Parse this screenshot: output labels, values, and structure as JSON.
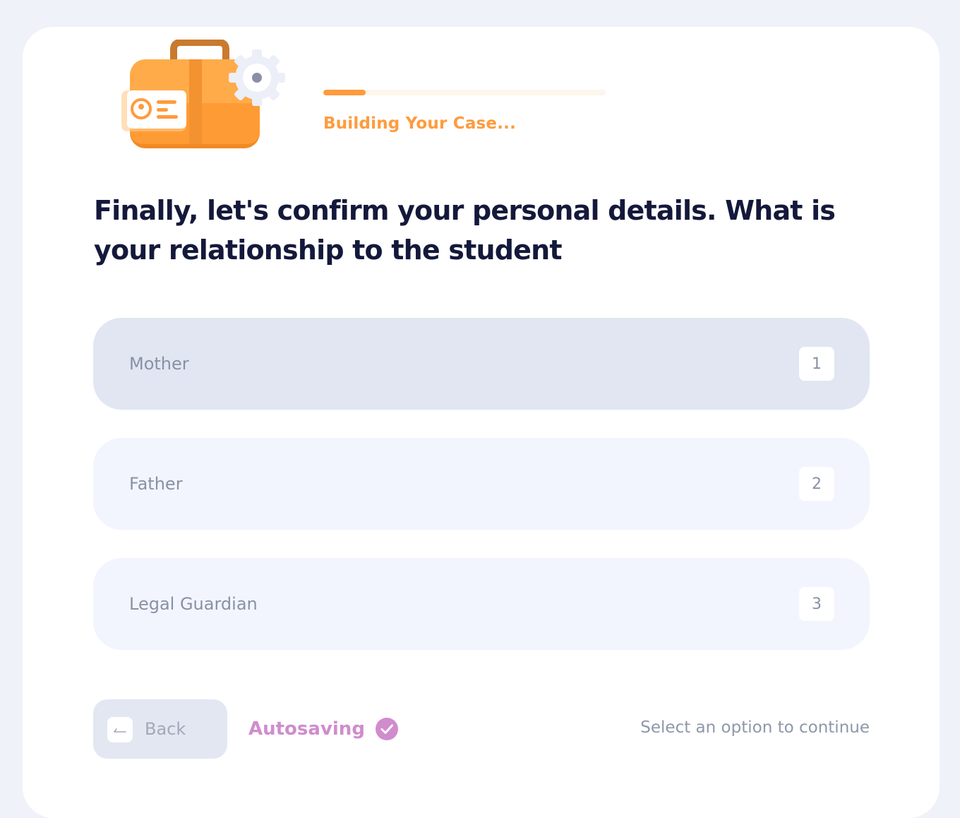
{
  "progress": {
    "label": "Building Your Case...",
    "value_fraction": 0.15
  },
  "question": {
    "text": "Finally, let's confirm your personal details. What is your relationship to the student"
  },
  "options": [
    {
      "label": "Mother",
      "key": "1",
      "state": "hovered"
    },
    {
      "label": "Father",
      "key": "2",
      "state": "default"
    },
    {
      "label": "Legal Guardian",
      "key": "3",
      "state": "default"
    }
  ],
  "footer": {
    "back_label": "Back",
    "autosave_label": "Autosaving",
    "hint": "Select an option to continue"
  },
  "icons": {
    "illustration": "briefcase-gear-illustration",
    "back": "arrow-left-icon",
    "autosave": "checkmark-circle-icon"
  },
  "colors": {
    "accent": "#ff9b3d",
    "heading": "#14193b",
    "option_bg": "#f2f5fe",
    "option_hover_bg": "#e1e6f2",
    "autosave": "#d08ccd"
  }
}
